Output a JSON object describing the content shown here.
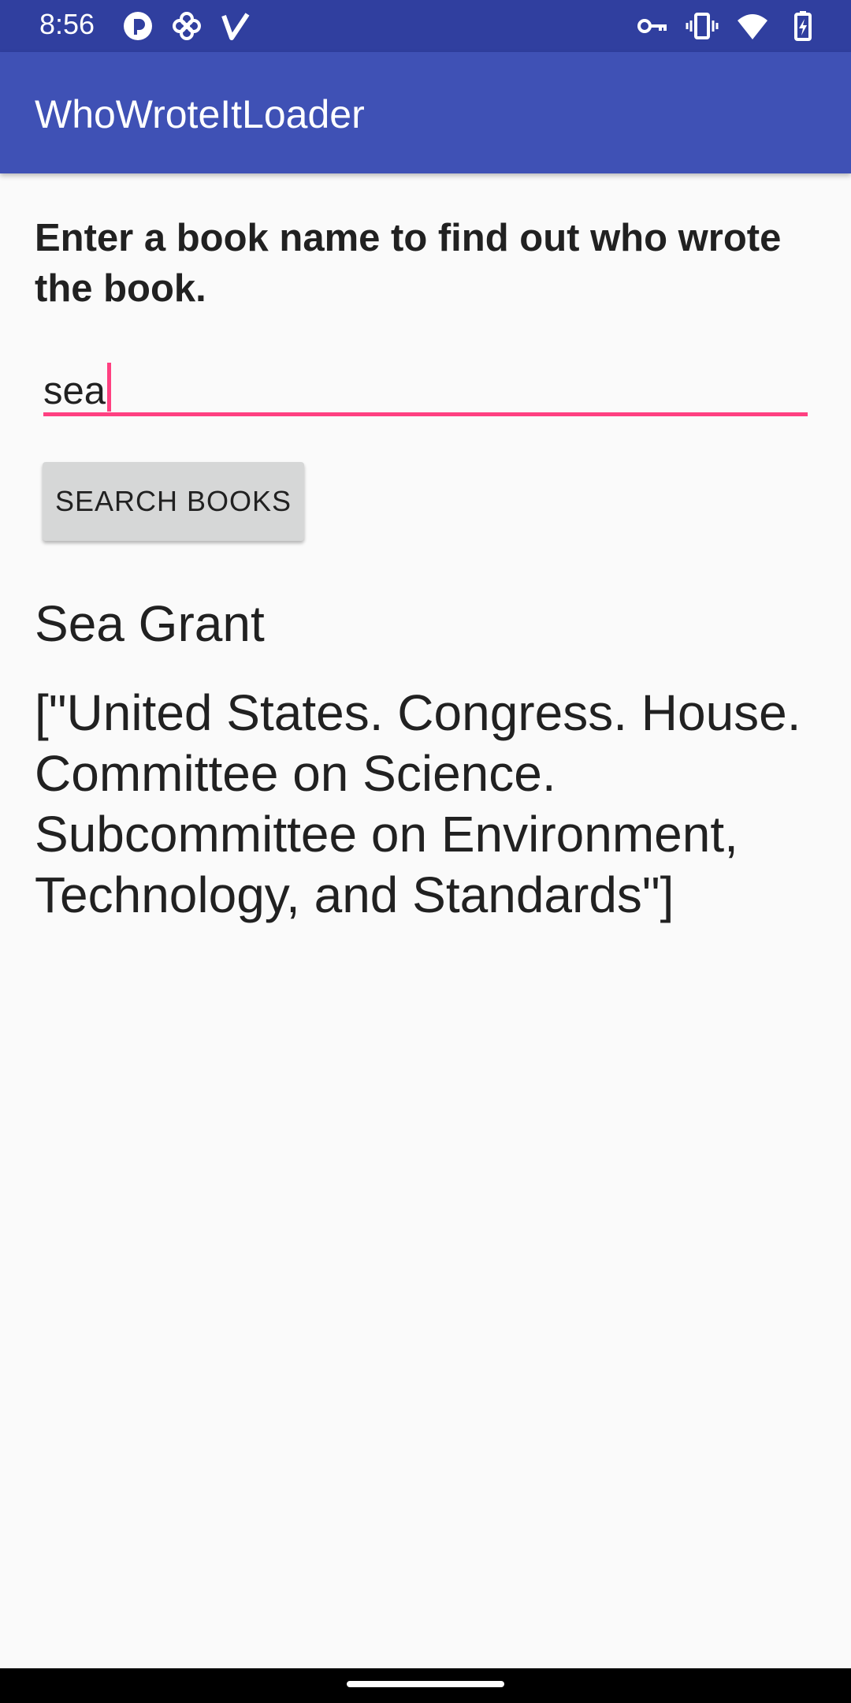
{
  "status_bar": {
    "time": "8:56",
    "left_icons": [
      "brand-app-icon",
      "pinwheel-icon",
      "v-logo-icon"
    ],
    "right_icons": [
      "vpn-key-icon",
      "vibrate-icon",
      "wifi-icon",
      "battery-charging-icon"
    ]
  },
  "app_bar": {
    "title": "WhoWroteItLoader",
    "color": "#3f51b5",
    "status_color": "#303f9f"
  },
  "main": {
    "instructions": "Enter a book name to find out who wrote the book.",
    "search_input": {
      "value": "sea",
      "accent_color": "#ff4081"
    },
    "search_button_label": "SEARCH BOOKS",
    "result_title": "Sea Grant",
    "result_authors": "[\"United States. Congress. House. Committee on Science. Subcommittee on Environment, Technology, and Standards\"]"
  }
}
